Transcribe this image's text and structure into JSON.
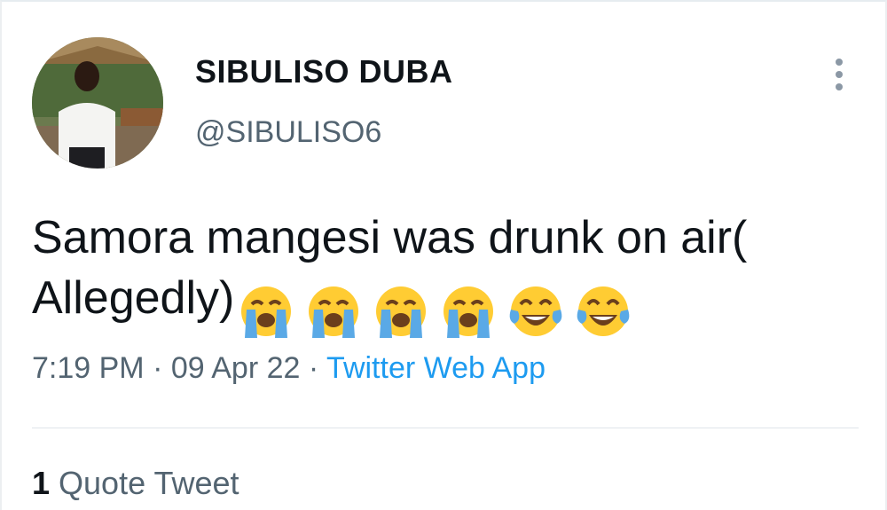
{
  "tweet": {
    "author": {
      "display_name": "SIBULISO DUBA",
      "handle": "@SIBULISO6"
    },
    "text": "Samora mangesi was drunk on air( Allegedly)",
    "emojis": [
      "loudly-crying-face",
      "loudly-crying-face",
      "loudly-crying-face",
      "loudly-crying-face",
      "face-with-tears-of-joy",
      "face-with-tears-of-joy"
    ],
    "time": "7:19 PM",
    "separator": "·",
    "date": "09 Apr 22",
    "source": "Twitter Web App",
    "stats": {
      "quote_count": "1",
      "quote_label": "Quote Tweet"
    }
  },
  "colors": {
    "text": "#0f1419",
    "secondary": "#536471",
    "link": "#1d9bf0",
    "emoji_face": "#ffcc33",
    "emoji_tears": "#5aa9e6"
  }
}
